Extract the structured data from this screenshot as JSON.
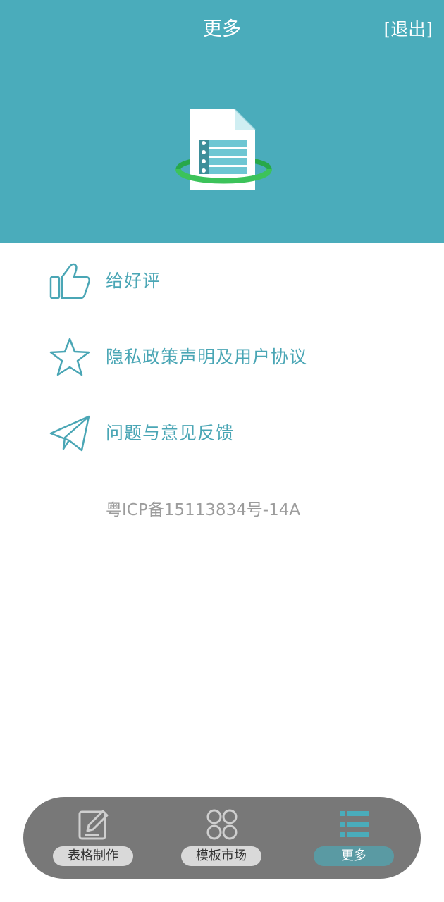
{
  "header": {
    "title": "更多",
    "logout_label": "[退出]"
  },
  "menu": {
    "items": [
      {
        "label": "给好评",
        "icon": "thumbs-up-icon"
      },
      {
        "label": "隐私政策声明及用户协议",
        "icon": "star-icon"
      },
      {
        "label": "问题与意见反馈",
        "icon": "paper-plane-icon"
      }
    ]
  },
  "icp": "粤ICP备15113834号-14A",
  "tabbar": {
    "tabs": [
      {
        "label": "表格制作",
        "icon": "edit-icon",
        "active": false
      },
      {
        "label": "模板市场",
        "icon": "grid-icon",
        "active": false
      },
      {
        "label": "更多",
        "icon": "list-icon",
        "active": true
      }
    ]
  },
  "colors": {
    "accent": "#4aacbb",
    "menu_text": "#4aa6b5",
    "tabbar_bg": "#787878",
    "tab_active": "#5a9aa3"
  }
}
